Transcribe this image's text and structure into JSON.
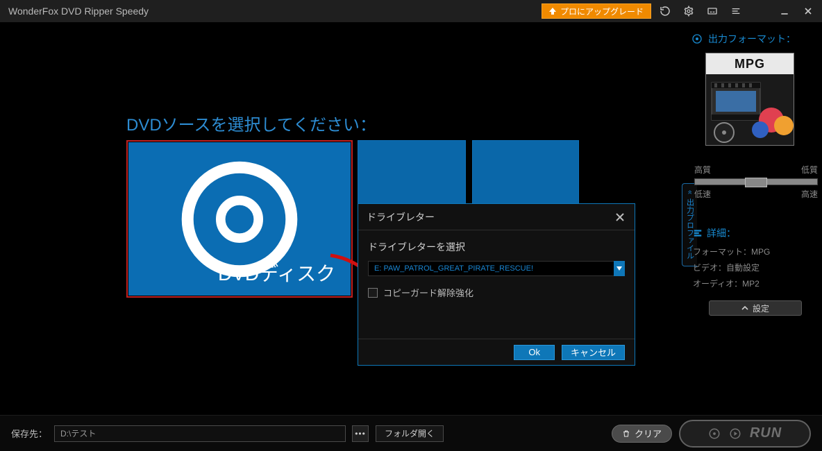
{
  "titlebar": {
    "app_title": "WonderFox DVD Ripper Speedy",
    "upgrade_label": "プロにアップグレード"
  },
  "main": {
    "headline": "DVDソースを選択してください：",
    "tile_dvd_label": "DVDディスク"
  },
  "dialog": {
    "title": "ドライブレター",
    "prompt": "ドライブレターを選択",
    "selected": "E:  PAW_PATROL_GREAT_PIRATE_RESCUE!",
    "checkbox_label": "コピーガード解除強化",
    "ok": "Ok",
    "cancel": "キャンセル"
  },
  "side": {
    "tab_label": "出力プロファイル",
    "out_title": "出力フォーマット：",
    "format_name": "MPG",
    "quality_hi": "高質",
    "quality_lo": "低質",
    "speed_lo": "低速",
    "speed_hi": "高速",
    "details_title": "詳細：",
    "detail_format": "フォーマット：MPG",
    "detail_video": "ビデオ：自動設定",
    "detail_audio": "オーディオ：MP2",
    "settings_btn": "設定"
  },
  "bottom": {
    "save_label": "保存先：",
    "path": "D:\\テスト",
    "open_folder": "フォルダ開く",
    "clear": "クリア",
    "run": "RUN"
  }
}
